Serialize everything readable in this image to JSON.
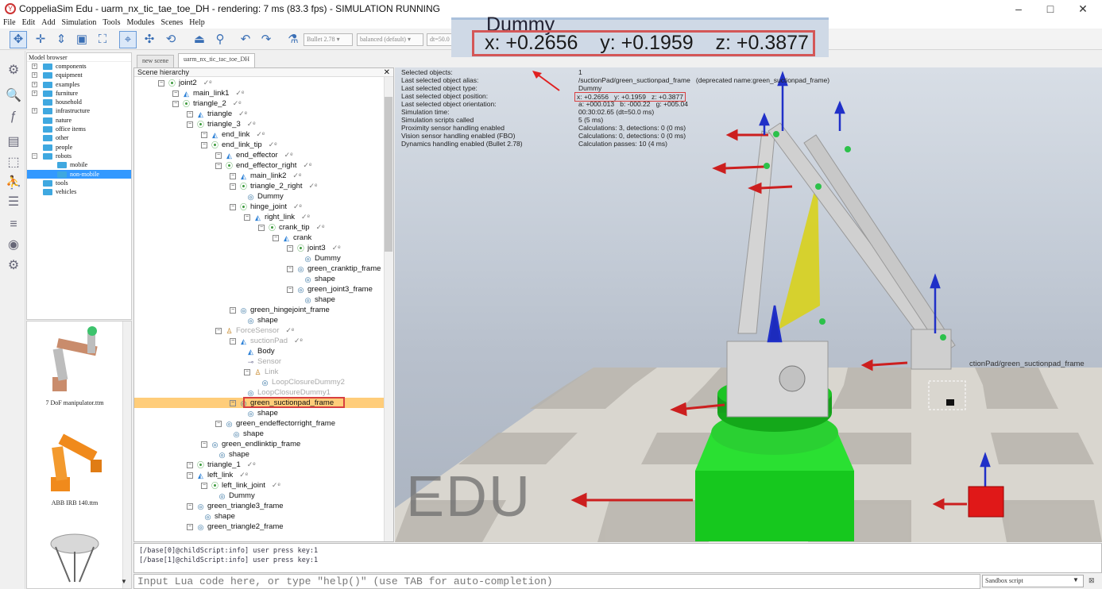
{
  "window": {
    "title": "CoppeliaSim Edu - uarm_nx_tic_tae_toe_DH - rendering: 7 ms (83.3 fps) - SIMULATION RUNNING",
    "minimize": "–",
    "maximize": "□",
    "close": "✕"
  },
  "menu": [
    "File",
    "Edit",
    "Add",
    "Simulation",
    "Tools",
    "Modules",
    "Scenes",
    "Help"
  ],
  "toolbar": {
    "engine": "Bullet 2.78",
    "mode": "balanced (default)",
    "dt": "dt=50.0"
  },
  "zoom_inset": {
    "object": "Dummy",
    "coords": "x: +0.2656    y: +0.1959    z: +0.3877"
  },
  "model_browser": {
    "title": "Model browser",
    "items": [
      {
        "label": "components",
        "expand": "+"
      },
      {
        "label": "equipment",
        "expand": "+"
      },
      {
        "label": "examples",
        "expand": "+"
      },
      {
        "label": "furniture",
        "expand": "+"
      },
      {
        "label": "household",
        "expand": ""
      },
      {
        "label": "infrastructure",
        "expand": "+"
      },
      {
        "label": "nature",
        "expand": ""
      },
      {
        "label": "office items",
        "expand": ""
      },
      {
        "label": "other",
        "expand": ""
      },
      {
        "label": "people",
        "expand": ""
      },
      {
        "label": "robots",
        "expand": "−"
      }
    ],
    "sub_items": [
      "mobile",
      "non-mobile"
    ],
    "tail_items": [
      "tools",
      "vehicles"
    ]
  },
  "thumbnails": [
    "7 DoF manipulator.ttm",
    "ABB IRB 140.ttm"
  ],
  "tabs": [
    "new scene",
    "uarm_nx_tic_tac_toe_DH"
  ],
  "hierarchy": {
    "title": "Scene hierarchy",
    "close": "✕",
    "nodes": [
      {
        "label": "joint2",
        "type": "dummy",
        "ex": "−",
        "check": true
      },
      {
        "label": "main_link1",
        "type": "joint",
        "ex": "−",
        "check": true
      },
      {
        "label": "triangle_2",
        "type": "dummy",
        "ex": "−",
        "check": true
      },
      {
        "label": "triangle",
        "type": "joint",
        "ex": "−",
        "check": true
      },
      {
        "label": "triangle_3",
        "type": "dummy",
        "ex": "−",
        "check": true
      },
      {
        "label": "end_link",
        "type": "joint",
        "ex": "−",
        "check": true
      },
      {
        "label": "end_link_tip",
        "type": "dummy",
        "ex": "−",
        "check": true
      },
      {
        "label": "end_effector",
        "type": "joint",
        "ex": "−",
        "check": true
      },
      {
        "label": "end_effector_right",
        "type": "dummy",
        "ex": "−",
        "check": true
      },
      {
        "label": "main_link2",
        "type": "joint",
        "ex": "−",
        "check": true
      },
      {
        "label": "triangle_2_right",
        "type": "dummy",
        "ex": "−",
        "check": true
      },
      {
        "label": "Dummy",
        "type": "shape",
        "ex": "",
        "check": false
      },
      {
        "label": "hinge_joint",
        "type": "dummy",
        "ex": "−",
        "check": true
      },
      {
        "label": "right_link",
        "type": "joint",
        "ex": "−",
        "check": true
      },
      {
        "label": "crank_tip",
        "type": "dummy",
        "ex": "−",
        "check": true
      },
      {
        "label": "crank",
        "type": "joint",
        "ex": "−",
        "check": false
      },
      {
        "label": "joint3",
        "type": "dummy",
        "ex": "−",
        "check": true
      },
      {
        "label": "Dummy",
        "type": "shape",
        "ex": "",
        "check": false
      },
      {
        "label": "green_cranktip_frame",
        "type": "shape",
        "ex": "−",
        "check": false
      },
      {
        "label": "shape",
        "type": "shape",
        "ex": "",
        "check": false
      },
      {
        "label": "green_joint3_frame",
        "type": "shape",
        "ex": "−",
        "check": false
      },
      {
        "label": "shape",
        "type": "shape",
        "ex": "",
        "check": false
      },
      {
        "label": "green_hingejoint_frame",
        "type": "shape",
        "ex": "−",
        "check": false
      },
      {
        "label": "shape",
        "type": "shape",
        "ex": "",
        "check": false
      },
      {
        "label": "ForceSensor",
        "type": "link",
        "ex": "−",
        "check": true
      },
      {
        "label": "suctionPad",
        "type": "joint",
        "ex": "−",
        "check": true
      },
      {
        "label": "Body",
        "type": "joint",
        "ex": "",
        "check": false
      },
      {
        "label": "Sensor",
        "type": "sens",
        "ex": "",
        "check": false
      },
      {
        "label": "Link",
        "type": "link",
        "ex": "−",
        "check": false
      },
      {
        "label": "LoopClosureDummy2",
        "type": "shape",
        "ex": "",
        "check": false
      },
      {
        "label": "LoopClosureDummy1",
        "type": "shape",
        "ex": "",
        "check": false
      },
      {
        "label": "green_suctionpad_frame",
        "type": "shape",
        "ex": "−",
        "check": false
      },
      {
        "label": "shape",
        "type": "shape",
        "ex": "",
        "check": false
      },
      {
        "label": "green_endeffectorright_frame",
        "type": "shape",
        "ex": "−",
        "check": false
      },
      {
        "label": "shape",
        "type": "shape",
        "ex": "",
        "check": false
      },
      {
        "label": "green_endlinktip_frame",
        "type": "shape",
        "ex": "−",
        "check": false
      },
      {
        "label": "shape",
        "type": "shape",
        "ex": "",
        "check": false
      },
      {
        "label": "triangle_1",
        "type": "dummy",
        "ex": "−",
        "check": true
      },
      {
        "label": "left_link",
        "type": "joint",
        "ex": "−",
        "check": true
      },
      {
        "label": "left_link_joint",
        "type": "dummy",
        "ex": "−",
        "check": true
      },
      {
        "label": "Dummy",
        "type": "shape",
        "ex": "",
        "check": false
      },
      {
        "label": "green_triangle3_frame",
        "type": "shape",
        "ex": "−",
        "check": false
      },
      {
        "label": "shape",
        "type": "shape",
        "ex": "",
        "check": false
      },
      {
        "label": "green_triangle2_frame",
        "type": "shape",
        "ex": "−",
        "check": false
      }
    ]
  },
  "info": {
    "labels": [
      "Selected objects:",
      "Last selected object alias:",
      "Last selected object type:",
      "Last selected object position:",
      "Last selected object orientation:",
      "Simulation time:",
      "Simulation scripts called",
      "Proximity sensor handling enabled",
      "Vision sensor handling enabled (FBO)",
      "Dynamics handling enabled (Bullet 2.78)"
    ],
    "values": [
      "1",
      "/suctionPad/green_suctionpad_frame   (deprecated name:green_suctionpad_frame)",
      "Dummy",
      "x: +0.2656   y: +0.1959   z: +0.3877",
      "a: +000.013   b: -000.22   g: +005.04",
      "00:30:02.65 (dt=50.0 ms)",
      "5 (5 ms)",
      "Calculations: 3, detections: 0 (0 ms)",
      "Calculations: 0, detections: 0 (0 ms)",
      "Calculation passes: 10 (4 ms)"
    ]
  },
  "viewport": {
    "watermark": "EDU",
    "object_label": "ctionPad/green_suctionpad_frame"
  },
  "console": {
    "lines": [
      "[/base[0]@childScript:info] user press key:1",
      "[/base[1]@childScript:info] user press key:1"
    ],
    "input_placeholder": "Input Lua code here, or type \"help()\" (use TAB for auto-completion)",
    "script_mode": "Sandbox script"
  }
}
